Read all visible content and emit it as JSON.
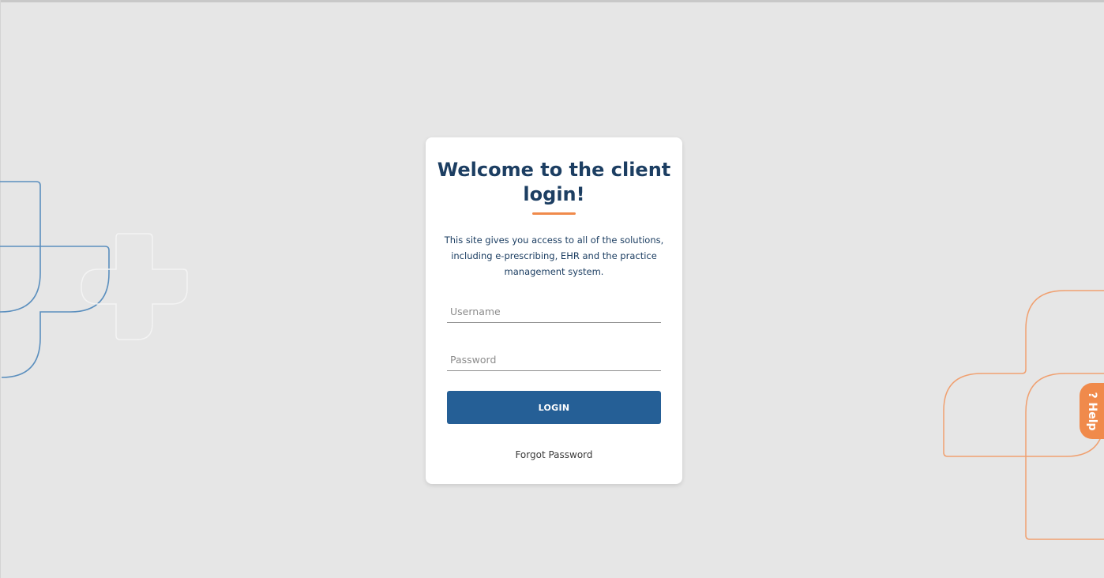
{
  "login_card": {
    "title": "Welcome to the client login!",
    "intro": "This site gives you access to all of the solutions, including e-prescribing, EHR and the practice management system.",
    "username_placeholder": "Username",
    "password_placeholder": "Password",
    "login_label": "LOGIN",
    "forgot_label": "Forgot Password"
  },
  "help_tab": {
    "icon": "?",
    "label": "Help"
  },
  "colors": {
    "background": "#e6e6e6",
    "primary_blue": "#255f96",
    "heading_navy": "#1c3e62",
    "accent_orange": "#f08a4b"
  },
  "icons": {
    "help": "question-mark-icon",
    "decor_left": "cross-outline-decoration",
    "decor_right": "cross-outline-decoration"
  }
}
